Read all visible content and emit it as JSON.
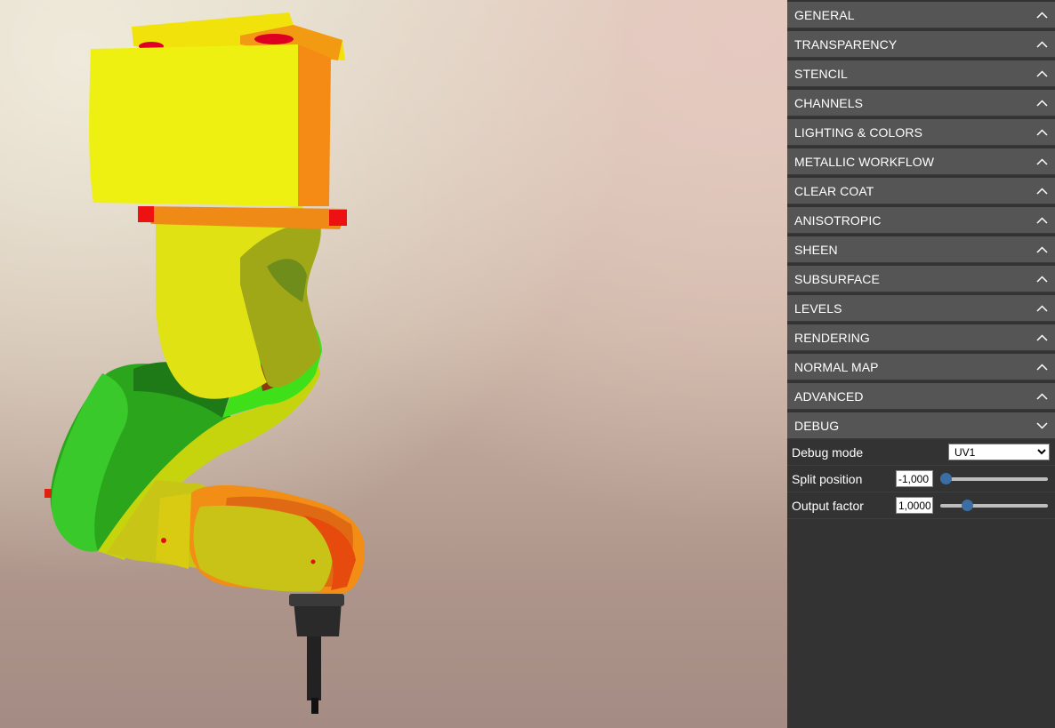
{
  "viewport": {
    "model": "robot-arm-debug-uv1"
  },
  "panel": {
    "sections": [
      {
        "label": "GENERAL",
        "expanded": false
      },
      {
        "label": "TRANSPARENCY",
        "expanded": false
      },
      {
        "label": "STENCIL",
        "expanded": false
      },
      {
        "label": "CHANNELS",
        "expanded": false
      },
      {
        "label": "LIGHTING & COLORS",
        "expanded": false
      },
      {
        "label": "METALLIC WORKFLOW",
        "expanded": false
      },
      {
        "label": "CLEAR COAT",
        "expanded": false
      },
      {
        "label": "ANISOTROPIC",
        "expanded": false
      },
      {
        "label": "SHEEN",
        "expanded": false
      },
      {
        "label": "SUBSURFACE",
        "expanded": false
      },
      {
        "label": "LEVELS",
        "expanded": false
      },
      {
        "label": "RENDERING",
        "expanded": false
      },
      {
        "label": "NORMAL MAP",
        "expanded": false
      },
      {
        "label": "ADVANCED",
        "expanded": false
      },
      {
        "label": "DEBUG",
        "expanded": true
      }
    ],
    "debug": {
      "mode_label": "Debug mode",
      "mode_value": "UV1",
      "split_label": "Split position",
      "split_value": "-1,000",
      "split_slider_fraction": 0.0,
      "output_label": "Output factor",
      "output_value": "1,0000",
      "output_slider_fraction": 0.22
    }
  },
  "colors": {
    "panel_bg": "#333333",
    "section_bg": "#555555",
    "slider_thumb": "#3a6ea5"
  }
}
